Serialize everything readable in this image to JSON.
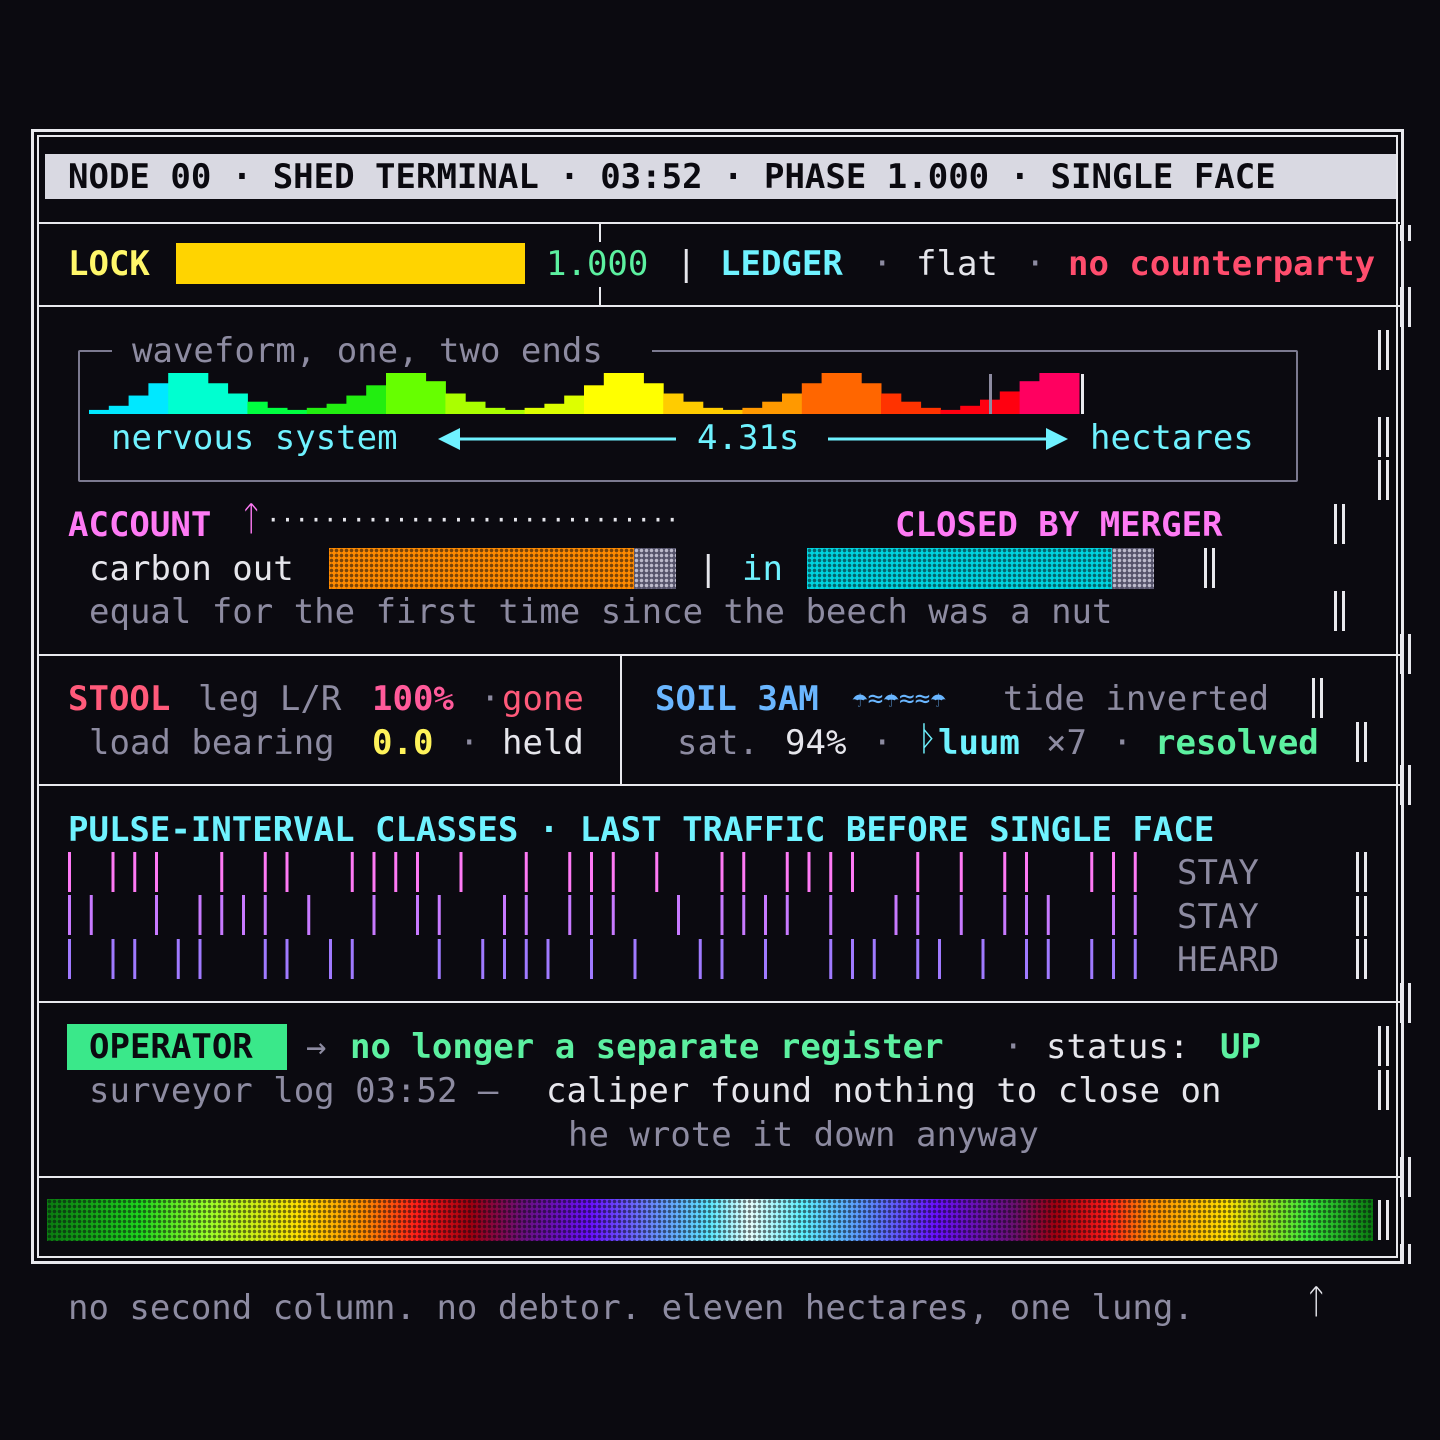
{
  "header": {
    "title": "NODE 00 · SHED TERMINAL · 03:52 · PHASE 1.000 · SINGLE FACE"
  },
  "lock": {
    "label": "LOCK",
    "value": "1.000",
    "level": 1.0,
    "sep": "|",
    "ledger_label": "LEDGER",
    "dot1": "·",
    "ledger_value": "flat",
    "dot2": "·",
    "status": "no counterparty"
  },
  "waveform": {
    "caption": "waveform, one, two ends",
    "left_label": "nervous system",
    "duration": "4.31s",
    "right_label": "hectares",
    "bars": [
      2,
      4,
      9,
      15,
      20,
      20,
      15,
      10,
      6,
      3,
      2,
      3,
      5,
      9,
      14,
      20,
      20,
      16,
      10,
      6,
      3,
      2,
      3,
      5,
      9,
      14,
      20,
      20,
      15,
      10,
      6,
      3,
      2,
      3,
      6,
      10,
      15,
      20,
      20,
      15,
      10,
      6,
      3,
      2,
      4,
      7,
      11,
      16,
      20,
      20
    ]
  },
  "account": {
    "label": "ACCOUNT",
    "rune": "ᛏ",
    "dots": "·····························",
    "status": "CLOSED BY MERGER",
    "carbon_out_label": "carbon out",
    "carbon_out_fill": 0.88,
    "sep": "|",
    "in_label": "in",
    "in_fill": 0.88,
    "note": "equal for the first time since the beech was a nut"
  },
  "stool": {
    "label": "STOOL",
    "leg": "leg L/R",
    "pct": "100%",
    "dot": "·",
    "gone": "gone",
    "load_label": "load bearing",
    "load_value": "0.0",
    "dot2": "·",
    "held": "held"
  },
  "soil": {
    "label": "SOIL 3AM",
    "icons": "☂≈☂≈≈☂",
    "tide": "tide inverted",
    "sat_label": "sat.",
    "sat_value": "94%",
    "dot": "·",
    "luum_glyph": "ᚦ",
    "luum": "luum",
    "times": "×7",
    "dot2": "·",
    "resolved": "resolved"
  },
  "pulse": {
    "title": "PULSE-INTERVAL CLASSES · LAST TRAFFIC BEFORE SINGLE FACE",
    "rows": [
      {
        "label": "STAY",
        "ticks": [
          0,
          2,
          3,
          4,
          7,
          9,
          10,
          13,
          14,
          15,
          16,
          18,
          21,
          23,
          24,
          25,
          27,
          30,
          31,
          33,
          34,
          35,
          36,
          39,
          41,
          43,
          44,
          47,
          48,
          49
        ]
      },
      {
        "label": "STAY",
        "ticks": [
          0,
          1,
          4,
          6,
          7,
          8,
          9,
          11,
          14,
          16,
          17,
          20,
          21,
          23,
          24,
          25,
          28,
          30,
          31,
          32,
          33,
          35,
          38,
          39,
          41,
          43,
          44,
          45,
          48,
          49
        ]
      },
      {
        "label": "HEARD",
        "ticks": [
          0,
          2,
          3,
          5,
          6,
          9,
          10,
          12,
          13,
          17,
          19,
          20,
          21,
          22,
          24,
          26,
          29,
          30,
          32,
          35,
          36,
          37,
          39,
          40,
          42,
          44,
          45,
          47,
          48,
          49
        ]
      }
    ]
  },
  "operator": {
    "badge": "OPERATOR",
    "arrow": "→",
    "message": "no longer a separate register",
    "dot": "·",
    "status_label": "status:",
    "status_value": "UP",
    "log_label": "surveyor log 03:52 —",
    "log_text": "caliper found nothing to close on",
    "log_text2": "he wrote it down anyway"
  },
  "footer": {
    "text": "no second column. no debtor. eleven hectares, one lung.",
    "rune": "ᛏ"
  },
  "colors": {
    "background": "#0b0a10",
    "yellow": "#ffd400",
    "lock_label": "#fff76a",
    "mint": "#5cf0a0",
    "cyan": "#6ff2ff",
    "pink": "#ff5a7a",
    "magenta": "#ff7af5",
    "blue": "#6ab6ff",
    "orange": "#ff8a00",
    "teal": "#00d4e0",
    "green_badge": "#3ae88a",
    "grey": "#8d8ba1"
  }
}
